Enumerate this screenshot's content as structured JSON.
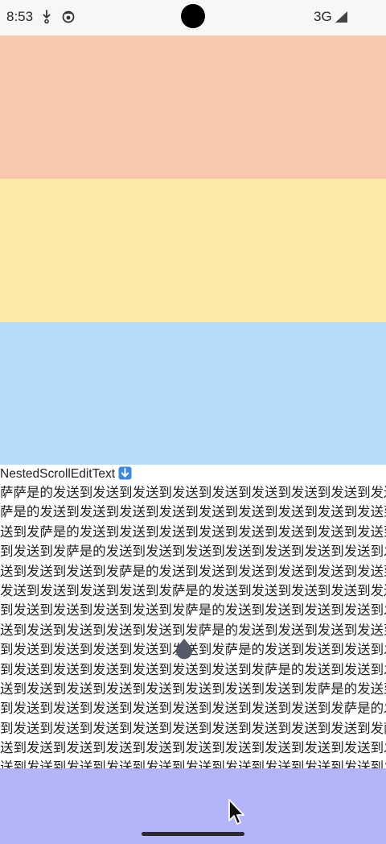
{
  "status_bar": {
    "time": "8:53",
    "network": "3G",
    "icons": [
      "download-notification-icon",
      "app-notification-icon",
      "signal-icon"
    ]
  },
  "colors": {
    "block_1": "#f7c8ad",
    "block_2": "#fbeba7",
    "block_3": "#b5dbfb",
    "bottom_block": "#b4b4fb"
  },
  "edit_text": {
    "label": "NestedScrollEditText",
    "label_icon": "down-arrow-emoji-icon",
    "lines": [
      "萨萨是的发送到发送到发送到发送到发送到发送到发送到发送到发送到",
      "萨是的发送到发送到发送到发送到发送到发送到发送到发送到发送到",
      "送到发萨是的发送到发送到发送到发送到发送到发送到发送到发送到发送",
      "到发送到发萨是的发送到发送到发送到发送到发送到发送到发送到发送到",
      "送到发送到发送到发萨是的发送到发送到发送到发送到发送到发送到发送",
      "发送到发送到发送到发送到发萨是的发送到发送到发送到发送到发送到发送",
      "到发送到发送到发送到发送到发萨是的发送到发送到发送到发送到发送到",
      "送到发送到发送到发送到发送到发萨是的发送到发送到发送到发送到发送到",
      "到发送到发送到发送到发送到发送到发萨是的发送到发送到发送到发送到发送",
      "到发送到发送到发送到发送到发送到发送到发萨是的发送到发送到发送到",
      "送到发送到发送到发送到发送到发送到发送到发送到发萨是的发送到发送到",
      "到发送到发送到发送到发送到发送到发送到发送到发送到发萨是的发送到发送",
      "到发送到发送到发送到发送到发送到发送到发送到发送到发送到发萨是的发送到",
      "送到发送到发送到发送到发送到发送到发送到发送到发送到发送到发萨是的发",
      "送到发送到发送到发送到发送到发送到发送到发送到发送到发送到发送到发萨是"
    ]
  }
}
